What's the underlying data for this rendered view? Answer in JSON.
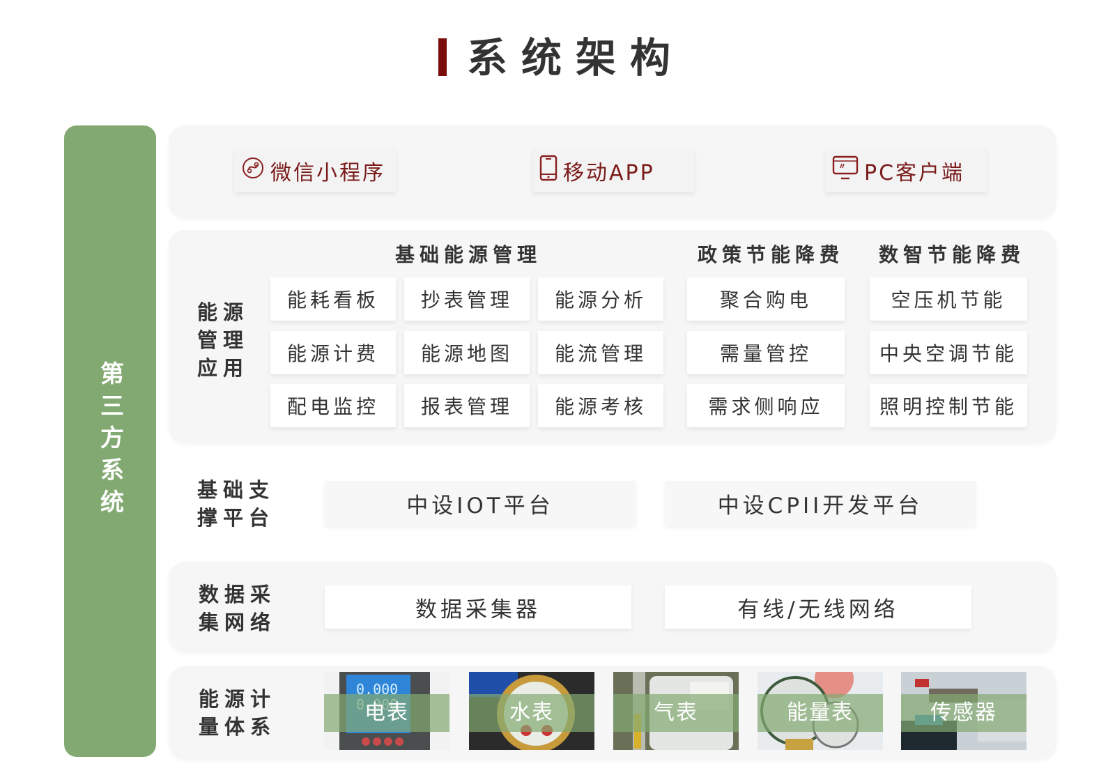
{
  "page": {
    "title": "系统架构",
    "accent_color": "#7a0c0c",
    "green_color": "#83a972"
  },
  "side": {
    "label": "第三方系统"
  },
  "clients": [
    {
      "label": "微信小程序",
      "icon": "mini-program-icon"
    },
    {
      "label": "移动APP",
      "icon": "mobile-phone-icon"
    },
    {
      "label": "PC客户端",
      "icon": "monitor-icon"
    }
  ],
  "energy_app": {
    "row_label": "能源管理应用",
    "groups": [
      {
        "title": "基础能源管理",
        "items": [
          "能耗看板",
          "抄表管理",
          "能源分析",
          "能源计费",
          "能源地图",
          "能流管理",
          "配电监控",
          "报表管理",
          "能源考核"
        ]
      },
      {
        "title": "政策节能降费",
        "items": [
          "聚合购电",
          "需量管控",
          "需求侧响应"
        ]
      },
      {
        "title": "数智节能降费",
        "items": [
          "空压机节能",
          "中央空调节能",
          "照明控制节能"
        ]
      }
    ]
  },
  "platform": {
    "row_label": "基础支撑平台",
    "items": [
      "中设IOT平台",
      "中设CPII开发平台"
    ]
  },
  "collection": {
    "row_label": "数据采集网络",
    "items": [
      "数据采集器",
      "有线/无线网络"
    ]
  },
  "metering": {
    "row_label": "能源计量体系",
    "items": [
      "电表",
      "水表",
      "气表",
      "能量表",
      "传感器"
    ]
  }
}
